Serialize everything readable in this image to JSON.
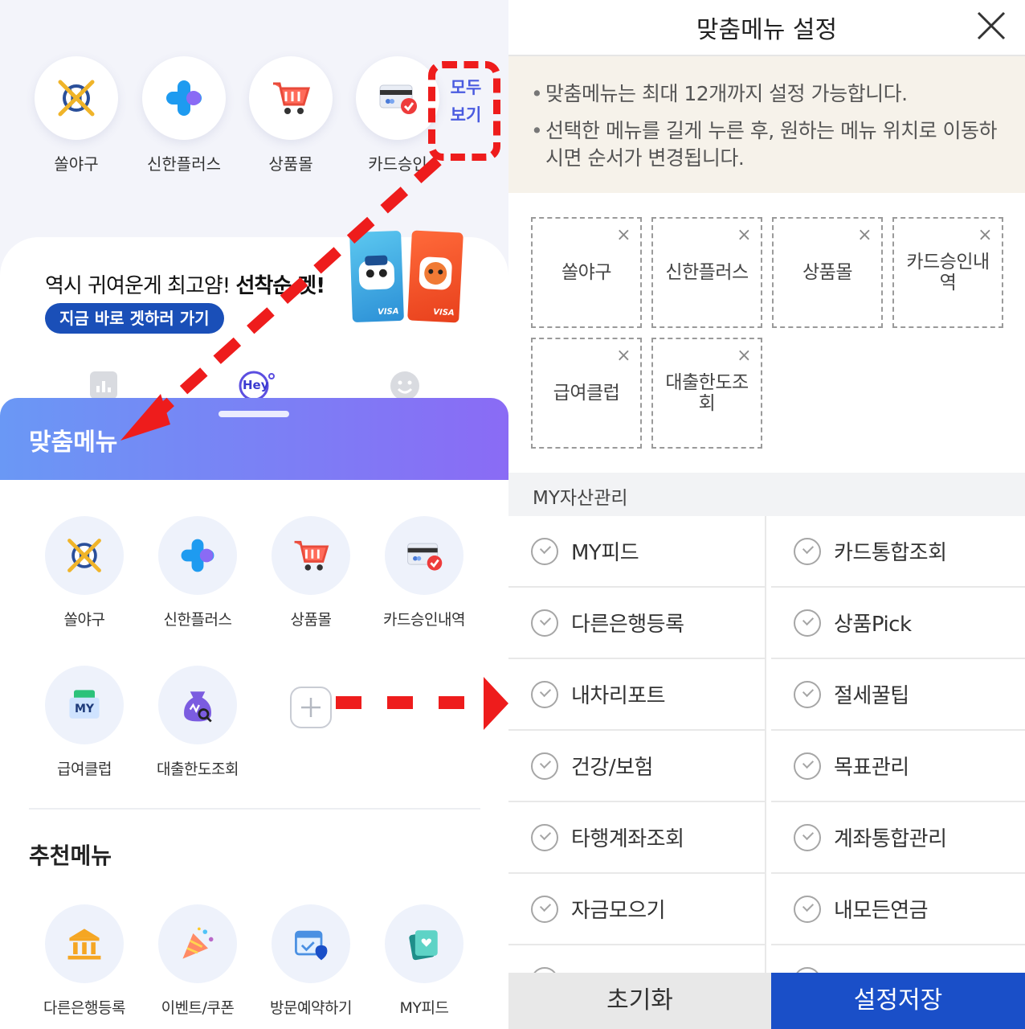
{
  "left": {
    "top_menu": [
      {
        "label": "쏠야구",
        "icon": "baseball-icon"
      },
      {
        "label": "신한플러스",
        "icon": "plus-flower-icon"
      },
      {
        "label": "상품몰",
        "icon": "cart-icon"
      },
      {
        "label": "카드승인",
        "icon": "card-approval-icon"
      }
    ],
    "see_all": [
      "모두",
      "보기"
    ],
    "promo": {
      "title_normal": "역시 귀여운게 최고얌! ",
      "title_bold": "선착순 겟!",
      "button": "지금 바로 겟하러 가기",
      "card_brand": "VISA"
    },
    "hey_label": "Hey",
    "sheet": {
      "title": "맞춤메뉴",
      "items": [
        {
          "label": "쏠야구",
          "icon": "baseball-icon"
        },
        {
          "label": "신한플러스",
          "icon": "plus-flower-icon"
        },
        {
          "label": "상품몰",
          "icon": "cart-icon"
        },
        {
          "label": "카드승인내역",
          "icon": "card-approval-icon"
        },
        {
          "label": "급여클럽",
          "icon": "salary-club-icon"
        },
        {
          "label": "대출한도조회",
          "icon": "loan-limit-icon"
        }
      ],
      "recommend_title": "추천메뉴",
      "recommend_items": [
        {
          "label": "다른은행등록",
          "icon": "bank-icon"
        },
        {
          "label": "이벤트/쿠폰",
          "icon": "party-popper-icon"
        },
        {
          "label": "방문예약하기",
          "icon": "calendar-check-icon"
        },
        {
          "label": "MY피드",
          "icon": "my-feed-icon"
        }
      ],
      "salary_badge": "MY"
    },
    "accent_red": "#ee1c1c",
    "brand_blue": "#1a4fb8"
  },
  "right": {
    "title": "맞춤메뉴 설정",
    "notices": [
      "맞춤메뉴는 최대 12개까지 설정 가능합니다.",
      "선택한 메뉴를 길게 누른 후, 원하는 메뉴 위치로 이동하시면 순서가 변경됩니다."
    ],
    "slots": [
      "쏠야구",
      "신한플러스",
      "상품몰",
      "카드승인내역",
      "급여클럽",
      "대출한도조회"
    ],
    "slot_close": "×",
    "section_title": "MY자산관리",
    "menu": [
      [
        "MY피드",
        "카드통합조회"
      ],
      [
        "다른은행등록",
        "상품Pick"
      ],
      [
        "내차리포트",
        "절세꿀팁"
      ],
      [
        "건강/보험",
        "목표관리"
      ],
      [
        "타행계좌조회",
        "계좌통합관리"
      ],
      [
        "자금모으기",
        "내모든연금"
      ]
    ],
    "reset_button": "초기화",
    "save_button": "설정저장",
    "save_color": "#1a4fc8"
  }
}
